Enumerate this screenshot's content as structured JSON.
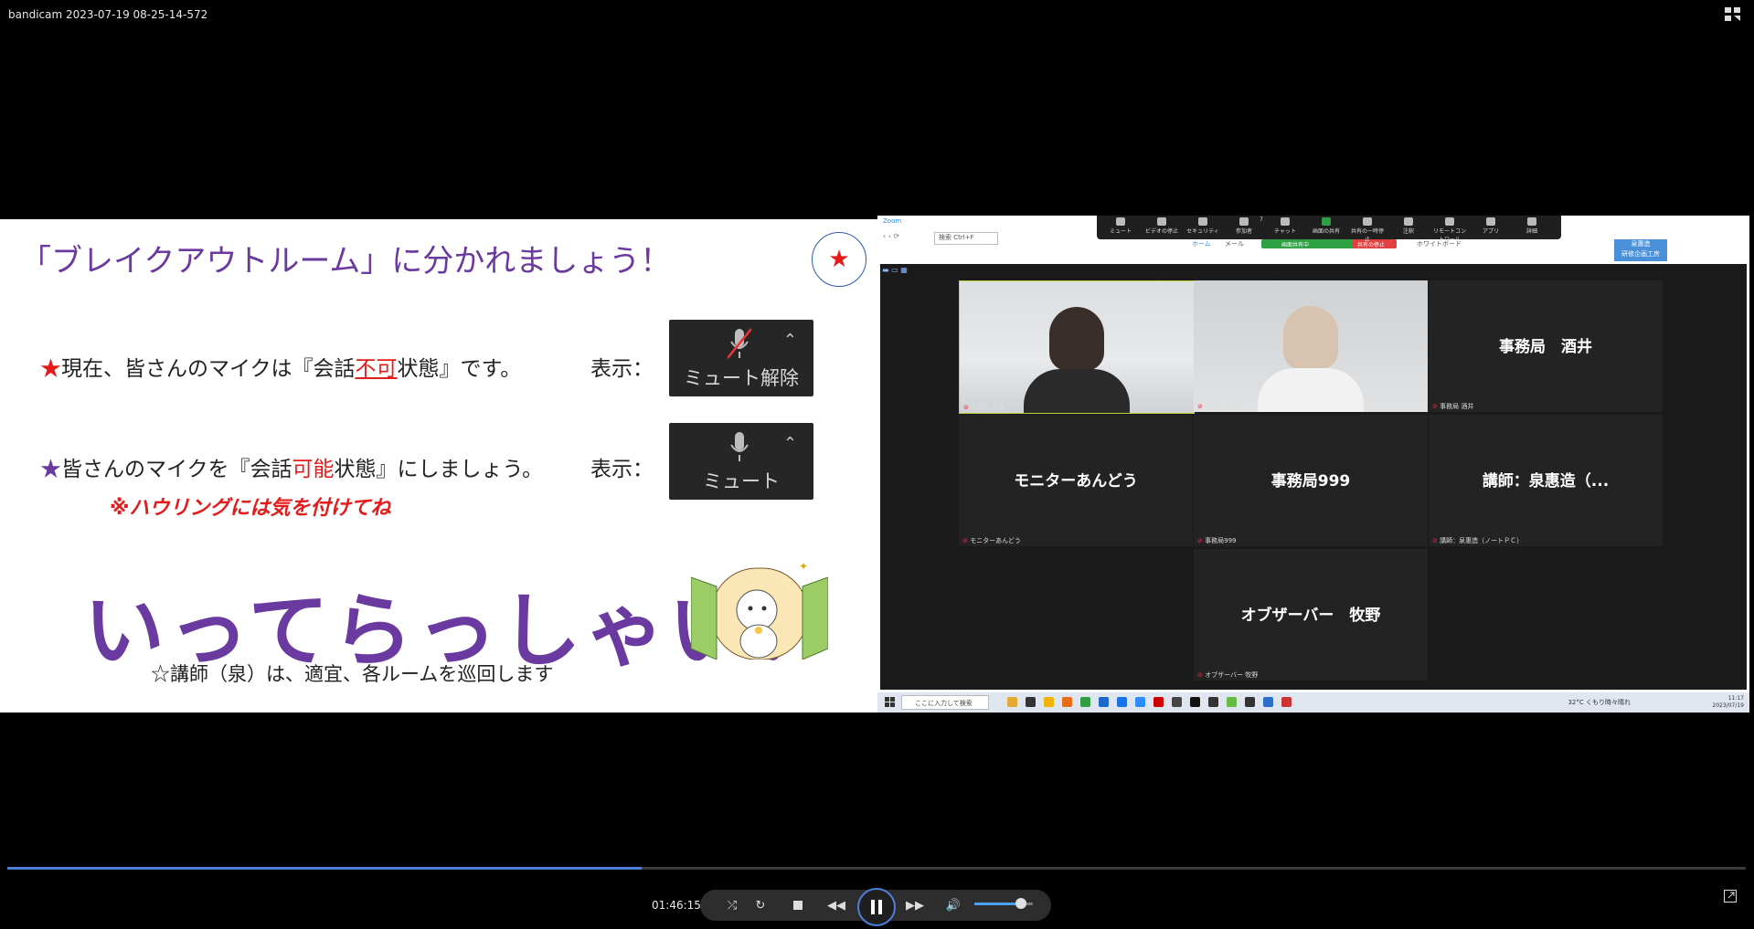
{
  "window": {
    "title": "bandicam 2023-07-19 08-25-14-572"
  },
  "slide": {
    "title": "「ブレイクアウトルーム」に分かれましょう！",
    "star_symbol": "★",
    "line1": {
      "star": "★",
      "before": "現在、皆さんのマイクは『会話",
      "highlight": "不可",
      "after": "状態』です。",
      "label": "表示："
    },
    "line2": {
      "star": "★",
      "before": "皆さんのマイクを『会話",
      "highlight": "可能",
      "after": "状態』にしましょう。",
      "label": "表示："
    },
    "button1_text": "ミュート解除",
    "button2_text": "ミュート",
    "howling_note": "※ハウリングには気を付けてね",
    "big_text": "いってらっしゃい！",
    "note": "☆講師（泉）は、適宜、各ルームを巡回します"
  },
  "zoom": {
    "app_title": "Zoom",
    "toolbar": [
      "ミュート",
      "ビデオの停止",
      "セキュリティ",
      "参加者",
      "チャット",
      "画面の共有",
      "共有の一時停止",
      "注釈",
      "リモートコントロール",
      "アプリ",
      "詳細"
    ],
    "participant_count": "7",
    "share_status": "画面共有中",
    "rec_status": "共有の停止",
    "sub_tabs": [
      "ホーム",
      "メール",
      "ホワイトボード"
    ],
    "search_placeholder": "検索",
    "search_shortcut": "Ctrl+F",
    "badge": "泉惠造\n研修企画工房",
    "tiles": [
      {
        "name": "",
        "caption": "事務局 安藤",
        "video": true
      },
      {
        "name": "",
        "caption": "講師：泉惠造",
        "video": true
      },
      {
        "name": "事務局　酒井",
        "caption": "事務局 酒井",
        "video": false
      },
      {
        "name": "モニターあんどう",
        "caption": "モニターあんどう",
        "video": false
      },
      {
        "name": "事務局999",
        "caption": "事務局999",
        "video": false
      },
      {
        "name": "講師：泉惠造（...",
        "caption": "講師：泉惠造（ノートＰＣ）",
        "video": false
      },
      {
        "name": "オブザーバー　牧野",
        "caption": "オブザーバー 牧野",
        "video": false
      }
    ],
    "taskbar": {
      "search_placeholder": "ここに入力して検索",
      "weather": "32°C くもり時々晴れ",
      "time": "11:17",
      "date": "2023/07/19"
    }
  },
  "player": {
    "timecode": "01:46:15",
    "progress_fraction": 0.365,
    "volume_fraction": 0.8,
    "accent_color": "#4d7fd8"
  },
  "colors": {
    "slide_purple": "#6b3aa0",
    "slide_red": "#e31b1b"
  }
}
